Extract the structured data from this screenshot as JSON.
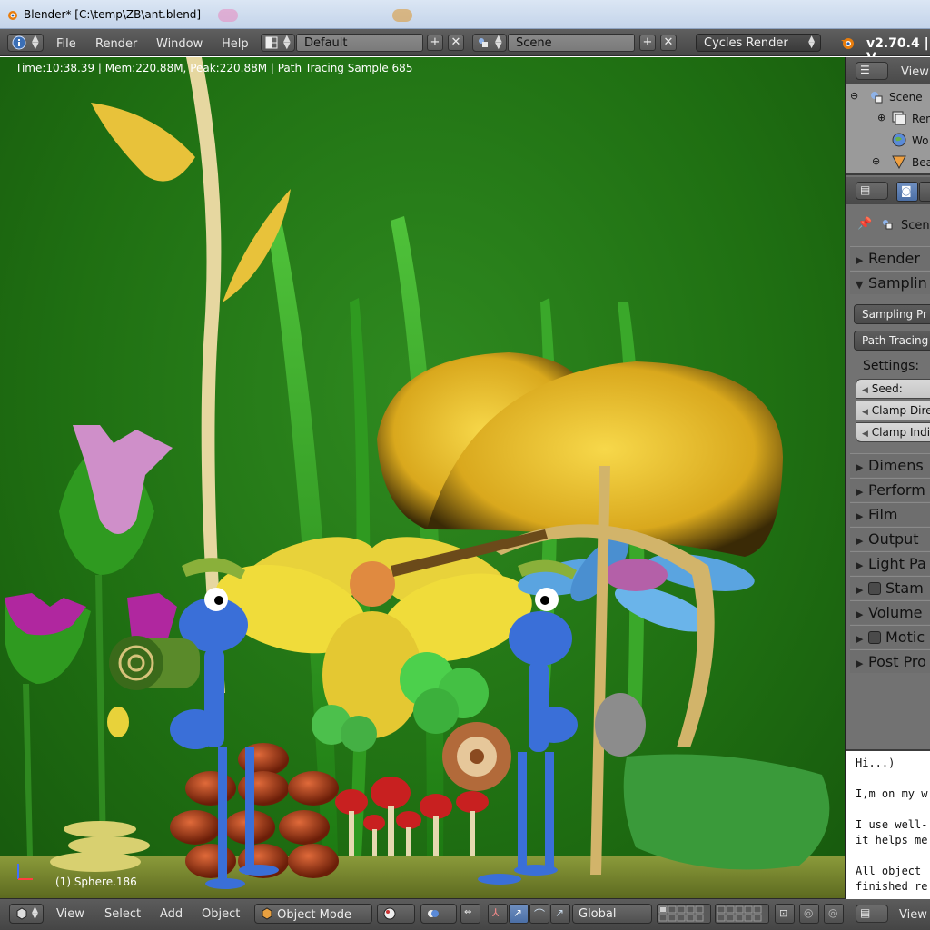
{
  "window": {
    "title": "Blender* [C:\\temp\\ZB\\ant.blend]"
  },
  "topbar": {
    "menus": [
      "File",
      "Render",
      "Window",
      "Help"
    ],
    "layout": "Default",
    "scene": "Scene",
    "renderer": "Cycles Render",
    "version": "v2.70.4 | V"
  },
  "viewport": {
    "info": "Time:10:38.39 | Mem:220.88M, Peak:220.88M | Path Tracing Sample 685",
    "object": "(1) Sphere.186"
  },
  "bottombar": {
    "menus": [
      "View",
      "Select",
      "Add",
      "Object"
    ],
    "mode": "Object Mode",
    "orientation": "Global"
  },
  "outliner": {
    "view": "View",
    "items": [
      "Scene",
      "Ren",
      "Wo",
      "Bea"
    ]
  },
  "properties": {
    "context": "Scen",
    "panels_top": [
      {
        "label": "Render",
        "open": false
      },
      {
        "label": "Samplin",
        "open": true
      }
    ],
    "sampling_presets": "Sampling Pr",
    "path_tracing": "Path Tracing",
    "settings_label": "Settings:",
    "fields": [
      "Seed:",
      "Clamp Dire",
      "Clamp Indi"
    ],
    "panels_bottom": [
      {
        "label": "Dimens",
        "checkbox": false
      },
      {
        "label": "Perform",
        "checkbox": false
      },
      {
        "label": "Film",
        "checkbox": false
      },
      {
        "label": "Output",
        "checkbox": false
      },
      {
        "label": "Light Pa",
        "checkbox": false
      },
      {
        "label": "Stam",
        "checkbox": true
      },
      {
        "label": "Volume",
        "checkbox": false
      },
      {
        "label": "Motic",
        "checkbox": true
      },
      {
        "label": "Post Pro",
        "checkbox": false
      }
    ]
  },
  "textpane": {
    "lines": [
      "Hi...)",
      "",
      "I,m on my w",
      "",
      "I use well-",
      "it helps me",
      "",
      "All object",
      "finished re"
    ],
    "footer_view": "View"
  },
  "colors": {
    "accent": "#e87d0d",
    "viewport_bg": "#237a16",
    "panel_bg": "#727272"
  }
}
